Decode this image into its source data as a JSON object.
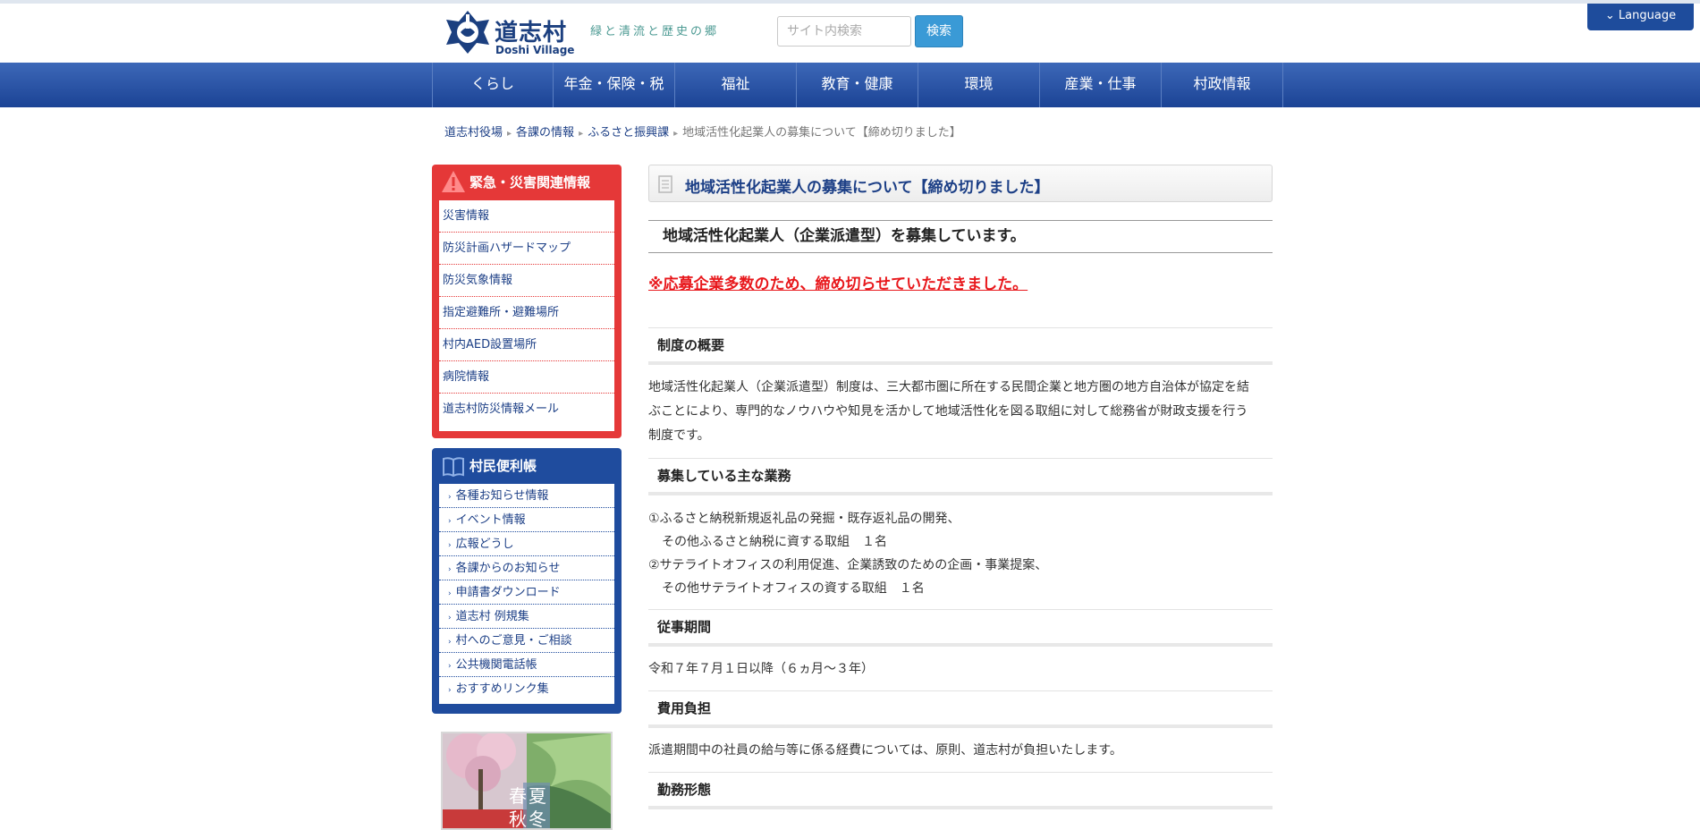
{
  "header": {
    "logo_title": "道志村",
    "logo_sub": "Doshi Village",
    "tagline": "緑と清流と歴史の郷",
    "search_placeholder": "サイト内検索",
    "search_button": "検索",
    "language_button": "⌄ Language"
  },
  "nav": [
    "くらし",
    "年金・保険・税",
    "福祉",
    "教育・健康",
    "環境",
    "産業・仕事",
    "村政情報"
  ],
  "breadcrumb": {
    "items": [
      "道志村役場",
      "各課の情報",
      "ふるさと振興課"
    ],
    "current": "地域活性化起業人の募集について【締め切りました】"
  },
  "emergency": {
    "title": "緊急・災害関連情報",
    "items": [
      "災害情報",
      "防災計画ハザードマップ",
      "防災気象情報",
      "指定避難所・避難場所",
      "村内AED設置場所",
      "病院情報",
      "道志村防災情報メール"
    ]
  },
  "convenience": {
    "title": "村民便利帳",
    "items": [
      "各種お知らせ情報",
      "イベント情報",
      "広報どうし",
      "各課からのお知らせ",
      "申請書ダウンロード",
      "道志村 例規集",
      "村へのご意見・ご相談",
      "公共機関電話帳",
      "おすすめリンク集"
    ]
  },
  "banner": {
    "seasons": [
      "春",
      "夏",
      "秋",
      "冬"
    ]
  },
  "article": {
    "title": "地域活性化起業人の募集について【締め切りました】",
    "lead": "地域活性化起業人（企業派遣型）を募集しています。",
    "notice": "※応募企業多数のため、締め切らせていただきました。",
    "sections": {
      "overview_head": "制度の概要",
      "overview_lines": [
        "地域活性化起業人（企業派遣型）制度は、三大都市圏に所在する民間企業と地方圏の地方自治体が協定を結",
        "ぶことにより、専門的なノウハウや知見を活かして地域活性化を図る取組に対して総務省が財政支援を行う",
        "制度です。"
      ],
      "duties_head": "募集している主な業務",
      "duties_lines": [
        "①ふるさと納税新規返礼品の発掘・既存返礼品の開発、",
        "その他ふるさと納税に資する取組　１名",
        "②サテライトオフィスの利用促進、企業誘致のための企画・事業提案、",
        "その他サテライトオフィスの資する取組　１名"
      ],
      "period_head": "従事期間",
      "period_text": "令和７年７月１日以降（６ヵ月～３年）",
      "cost_head": "費用負担",
      "cost_text": "派遣期間中の社員の給与等に係る経費については、原則、道志村が負担いたします。",
      "work_head": "勤務形態"
    }
  },
  "colors": {
    "brand_blue": "#1c3f86",
    "nav_blue": "#1b4395",
    "emergency_red": "#e53838",
    "notice_red": "#e8181c",
    "search_button": "#3a9ad6"
  }
}
